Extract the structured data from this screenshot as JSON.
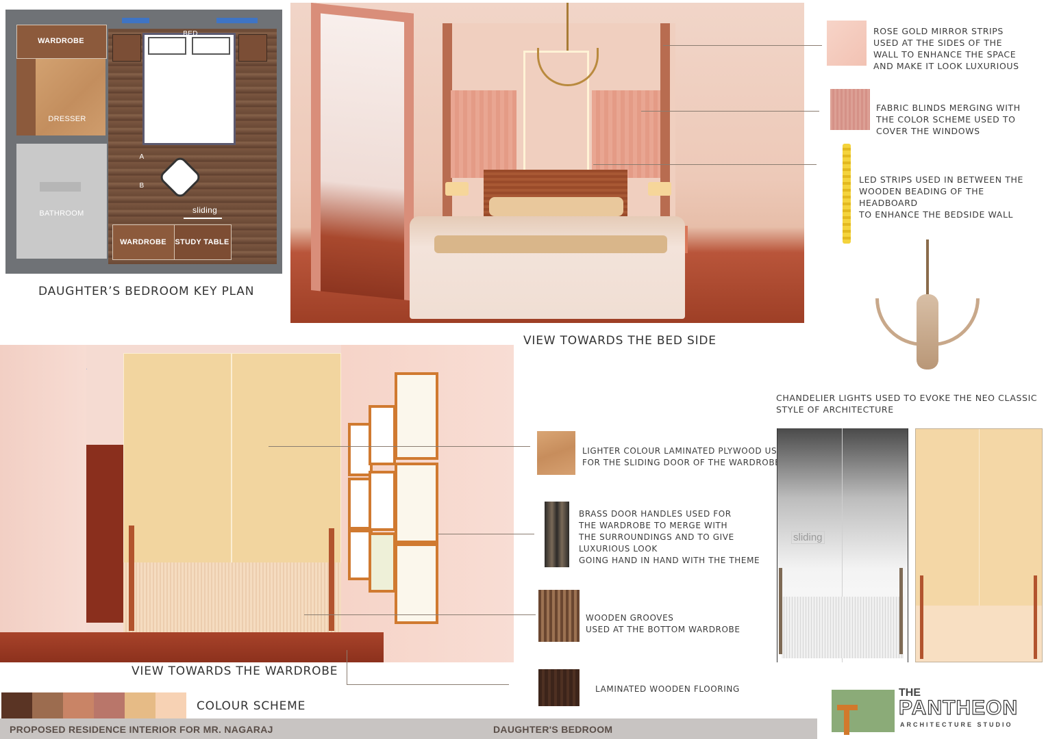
{
  "plan": {
    "caption": "DAUGHTER’S BEDROOM KEY PLAN",
    "labels": {
      "wardrobe_top": "WARDROBE",
      "dresser": "DRESSER",
      "bathroom": "BATHROOM",
      "bed": "BED",
      "wardrobe_bottom": "WARDROBE",
      "study_table": "STUDY TABLE",
      "sliding": "sliding",
      "section_a": "A",
      "section_b": "B"
    }
  },
  "views": {
    "bed_side_caption": "VIEW TOWARDS THE BED SIDE",
    "wardrobe_caption": "VIEW TOWARDS THE WARDROBE",
    "elevation_sliding": "sliding"
  },
  "notes": {
    "mirror": "ROSE GOLD MIRROR STRIPS\nUSED AT THE SIDES OF THE\nWALL TO ENHANCE THE SPACE\nAND MAKE IT LOOK LUXURIOUS",
    "blinds": "FABRIC BLINDS MERGING WITH\nTHE COLOR SCHEME USED TO\nCOVER THE WINDOWS",
    "led": "LED STRIPS USED IN BETWEEN THE\nWOODEN BEADING OF THE HEADBOARD\nTO ENHANCE THE BEDSIDE WALL",
    "chandelier": "CHANDELIER LIGHTS USED TO EVOKE THE NEO CLASSIC\nSTYLE OF ARCHITECTURE",
    "plywood": "LIGHTER COLOUR LAMINATED PLYWOOD USED\nFOR THE SLIDING DOOR OF THE WARDROBE",
    "handles": "BRASS DOOR HANDLES USED FOR\n THE WARDROBE TO MERGE WITH\n THE SURROUNDINGS AND TO GIVE\n  LUXURIOUS LOOK\n GOING HAND IN HAND WITH THE THEME",
    "grooves": "WOODEN GROOVES\nUSED AT THE BOTTOM WARDROBE",
    "flooring": "LAMINATED WOODEN FLOORING"
  },
  "colour_scheme": {
    "label": "COLOUR SCHEME",
    "swatches": [
      "#5a3424",
      "#9c6c4f",
      "#c98466",
      "#b9766a",
      "#e6bb86",
      "#f7d2b4"
    ]
  },
  "footer": {
    "project": "PROPOSED RESIDENCE INTERIOR FOR MR. NAGARAJ",
    "sheet": "DAUGHTER'S BEDROOM"
  },
  "logo": {
    "the": "THE",
    "name": "PANTHEON",
    "studio": "ARCHITECTURE STUDIO"
  }
}
